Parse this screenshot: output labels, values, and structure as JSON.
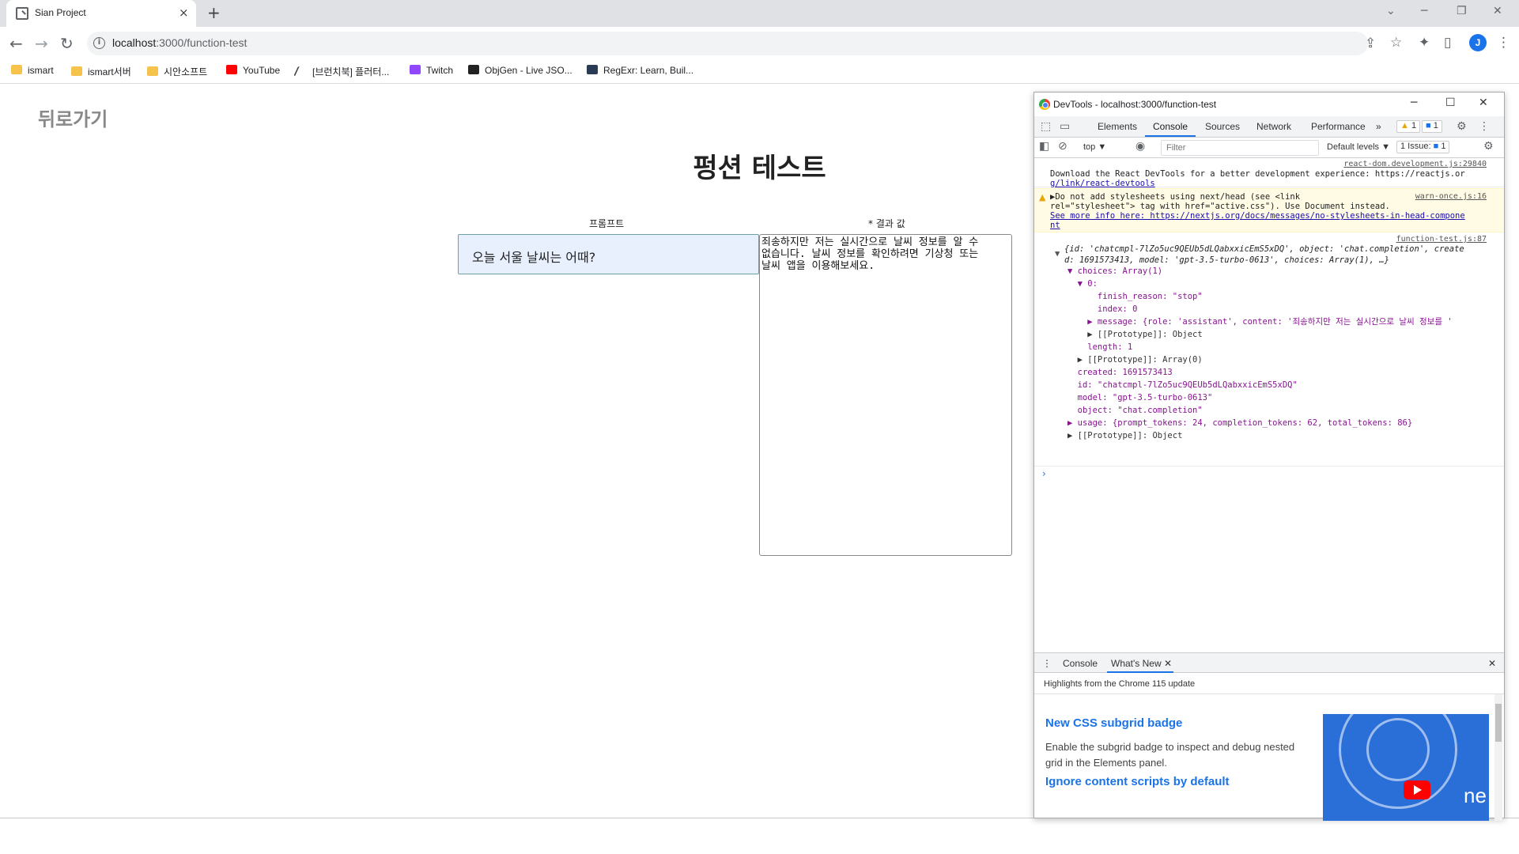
{
  "browser": {
    "tab_title": "Sian Project",
    "tab_close": "×",
    "new_tab": "+",
    "url_host": "localhost",
    "url_rest": ":3000/function-test",
    "bookmarks": [
      {
        "label": "ismart",
        "icon": "folder-icon"
      },
      {
        "label": "ismart서버",
        "icon": "folder-icon"
      },
      {
        "label": "시안소프트",
        "icon": "folder-icon"
      },
      {
        "label": "YouTube",
        "icon": "youtube-icon"
      },
      {
        "label": "[브런치북] 플러터...",
        "icon": "pen-icon"
      },
      {
        "label": "Twitch",
        "icon": "twitch-icon"
      },
      {
        "label": "ObjGen - Live JSO...",
        "icon": "objgen-icon"
      },
      {
        "label": "RegExr: Learn, Buil...",
        "icon": "regexr-icon"
      }
    ],
    "avatar_letter": "J"
  },
  "page": {
    "back_link": "뒤로가기",
    "title": "펑션 테스트",
    "prompt_label": "프롬프트",
    "result_label": "결과 값",
    "prompt_value": "오늘 서울 날씨는 어때?",
    "result_lines": [
      "죄송하지만 저는 실시간으로 날씨 정보를 알 수",
      "없습니다. 날씨 정보를 확인하려면 기상청 또는",
      "날씨 앱을 이용해보세요."
    ]
  },
  "devtools": {
    "window_title": "DevTools - localhost:3000/function-test",
    "tabs": [
      "Elements",
      "Console",
      "Sources",
      "Network",
      "Performance"
    ],
    "more_tabs": "»",
    "warn_count": "1",
    "info_count": "1",
    "context": "top",
    "filter_placeholder": "Filter",
    "levels": "Default levels",
    "issues_label": "1 Issue:",
    "issues_count": "1",
    "messages": {
      "react_src": "react-dom.development.js:29840",
      "react_line1": "Download the React DevTools for a better development experience: https://reactjs.or",
      "react_line2": "g/link/react-devtools",
      "warn_src": "warn-once.js:16",
      "warn_line1": "▶Do not add stylesheets using next/head (see <link",
      "warn_line2": "rel=\"stylesheet\"> tag with href=\"active.css\"). Use Document instead.",
      "warn_line3": "See more info here: https://nextjs.org/docs/messages/no-stylesheets-in-head-compone",
      "warn_line4": "nt",
      "obj_src": "function-test.js:87",
      "obj_summary1": "{id: 'chatcmpl-7lZo5uc9QEUb5dLQabxxicEmS5xDQ', object: 'chat.completion', create",
      "obj_summary2": "d: 1691573413, model: 'gpt-3.5-turbo-0613', choices: Array(1), …}",
      "tree": [
        "▼ choices: Array(1)",
        "  ▼ 0:",
        "      finish_reason: \"stop\"",
        "      index: 0",
        "    ▶ message: {role: 'assistant', content: '죄송하지만 저는 실시간으로 날씨 정보를 '",
        "    ▶ [[Prototype]]: Object",
        "    length: 1",
        "  ▶ [[Prototype]]: Array(0)",
        "  created: 1691573413",
        "  id: \"chatcmpl-7lZo5uc9QEUb5dLQabxxicEmS5xDQ\"",
        "  model: \"gpt-3.5-turbo-0613\"",
        "  object: \"chat.completion\"",
        "▶ usage: {prompt_tokens: 24, completion_tokens: 62, total_tokens: 86}",
        "▶ [[Prototype]]: Object"
      ]
    },
    "drawer_tabs": [
      "Console",
      "What's New"
    ],
    "whats_new_header": "Highlights from the Chrome 115 update",
    "wn_title1": "New CSS subgrid badge",
    "wn_text1": "Enable the subgrid badge to inspect and debug nested grid in the Elements panel.",
    "wn_title2": "Ignore content scripts by default",
    "wn_thumb_text": "ne"
  },
  "colors": {
    "accent": "#1a73e8",
    "prompt_bg": "#e8f0fe",
    "warn_bg": "#fffbe5"
  }
}
